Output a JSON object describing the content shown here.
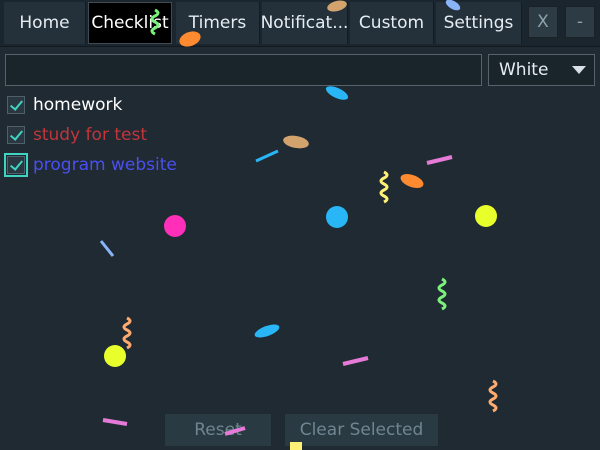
{
  "tabs": [
    {
      "label": "Home",
      "active": false
    },
    {
      "label": "Checklist",
      "active": true
    },
    {
      "label": "Timers",
      "active": false
    },
    {
      "label": "Notificat...",
      "active": false
    },
    {
      "label": "Custom",
      "active": false
    },
    {
      "label": "Settings",
      "active": false
    }
  ],
  "window_controls": {
    "close_label": "X",
    "minimize_label": "-"
  },
  "entry": {
    "value": "",
    "placeholder": ""
  },
  "color_select": {
    "selected": "White"
  },
  "checklist": [
    {
      "label": "homework",
      "checked": true,
      "color": "#ffffff"
    },
    {
      "label": "study for test",
      "checked": true,
      "color": "#c2353a"
    },
    {
      "label": "program website",
      "checked": true,
      "color": "#4a50f0"
    }
  ],
  "buttons": {
    "reset_label": "Reset",
    "clear_selected_label": "Clear Selected"
  },
  "colors": {
    "background": "#202a33",
    "accent": "#3fd4c0",
    "tab_active": "#000000"
  },
  "decoration": "confetti"
}
